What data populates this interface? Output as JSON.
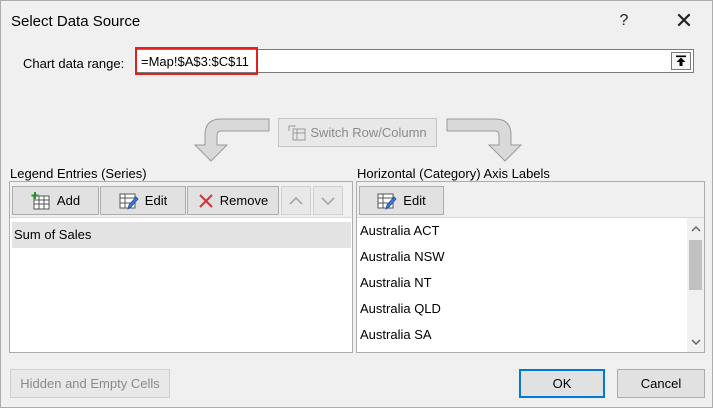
{
  "dialog": {
    "title": "Select Data Source",
    "help_label": "?",
    "close_label": "✕"
  },
  "range": {
    "label": "Chart data range:",
    "value": "=Map!$A$3:$C$11"
  },
  "switch_button": {
    "label": "Switch Row/Column"
  },
  "legend": {
    "label": "Legend Entries (Series)",
    "add_label": "Add",
    "edit_label": "Edit",
    "remove_label": "Remove",
    "items": [
      "Sum of Sales"
    ]
  },
  "axis": {
    "label": "Horizontal (Category) Axis Labels",
    "edit_label": "Edit",
    "items": [
      "Australia ACT",
      "Australia NSW",
      "Australia NT",
      "Australia QLD",
      "Australia SA"
    ]
  },
  "footer": {
    "hidden_cells_label": "Hidden and Empty Cells",
    "ok_label": "OK",
    "cancel_label": "Cancel"
  },
  "colors": {
    "highlight": "#e02020",
    "default_button_border": "#0078d7",
    "remove_icon": "#d13438"
  }
}
